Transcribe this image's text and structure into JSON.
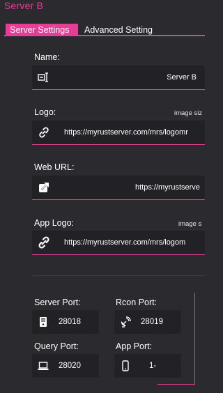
{
  "window": {
    "title": "Server B"
  },
  "tabs": [
    {
      "label": "Server Settings",
      "active": true
    },
    {
      "label": "Advanced Setting",
      "active": false
    }
  ],
  "fields": {
    "name": {
      "label": "Name:",
      "value": "Server B",
      "icon": "text-cursor-icon"
    },
    "logo": {
      "label": "Logo:",
      "hint": "image siz",
      "value": "https://myrustserver.com/mrs/logomr",
      "icon": "link-icon"
    },
    "web_url": {
      "label": "Web URL:",
      "value": "https://myrustserve",
      "icon": "external-link-icon"
    },
    "app_logo": {
      "label": "App Logo:",
      "hint": "image s",
      "value": "https://myrustserver.com/mrs/logom",
      "icon": "broken-link-icon"
    }
  },
  "ports": {
    "server": {
      "label": "Server Port:",
      "value": "28018",
      "icon": "server-icon"
    },
    "rcon": {
      "label": "Rcon Port:",
      "value": "28019",
      "icon": "satellite-dish-icon"
    },
    "query": {
      "label": "Query Port:",
      "value": "28020",
      "icon": "laptop-icon"
    },
    "app": {
      "label": "App Port:",
      "value": "1-",
      "icon": "mobile-phone-icon"
    }
  },
  "colors": {
    "accent": "#e83d97",
    "background": "#2b2a2f",
    "field": "#222126"
  }
}
